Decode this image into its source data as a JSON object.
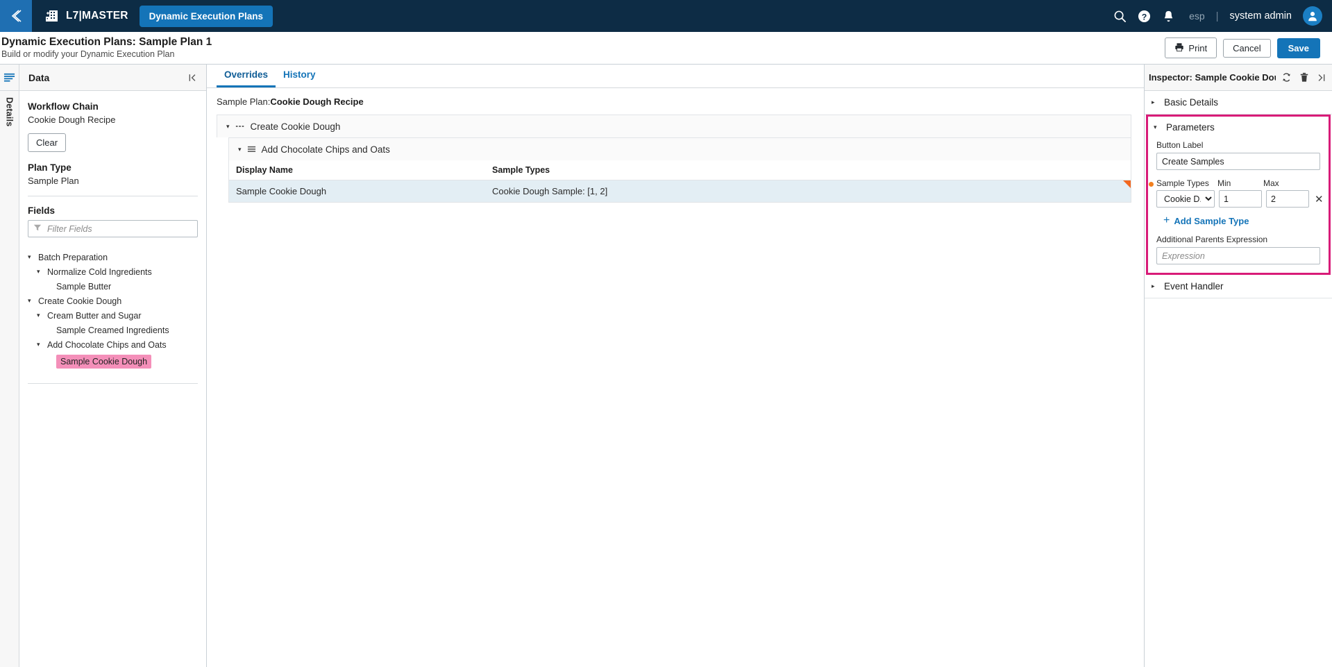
{
  "topnav": {
    "back_icon": "chevron-left-icon",
    "brand_logo_icon": "building-add-icon",
    "brand_name": "L7|MASTER",
    "active_tab": "Dynamic Execution Plans",
    "search_icon": "search-icon",
    "help_icon": "help-circle-icon",
    "notifications_icon": "bell-icon",
    "language": "esp",
    "separator": "|",
    "user": "system admin",
    "avatar_icon": "user-avatar-icon"
  },
  "pagehead": {
    "title": "Dynamic Execution Plans: Sample Plan 1",
    "subtitle": "Build or modify your Dynamic Execution Plan",
    "print_label": "Print",
    "print_icon": "printer-icon",
    "cancel_label": "Cancel",
    "save_label": "Save"
  },
  "rail": {
    "menu_icon": "hamburger-menu-icon",
    "details_tab": "Details"
  },
  "datapanel": {
    "header": "Data",
    "collapse_icon": "collapse-left-icon",
    "workflow_chain_label": "Workflow Chain",
    "workflow_chain_value": "Cookie Dough Recipe",
    "clear_label": "Clear",
    "plan_type_label": "Plan Type",
    "plan_type_value": "Sample Plan",
    "fields_label": "Fields",
    "filter_placeholder": "Filter Fields",
    "filter_value": "",
    "filter_icon": "funnel-icon",
    "tree": [
      {
        "label": "Batch Preparation",
        "depth": 0,
        "caret": "▾",
        "highlight": false
      },
      {
        "label": "Normalize Cold Ingredients",
        "depth": 1,
        "caret": "▾",
        "highlight": false
      },
      {
        "label": "Sample Butter",
        "depth": 2,
        "caret": "",
        "highlight": false
      },
      {
        "label": "Create Cookie Dough",
        "depth": 0,
        "caret": "▾",
        "highlight": false
      },
      {
        "label": "Cream Butter and Sugar",
        "depth": 1,
        "caret": "▾",
        "highlight": false
      },
      {
        "label": "Sample Creamed Ingredients",
        "depth": 2,
        "caret": "",
        "highlight": false
      },
      {
        "label": "Add Chocolate Chips and Oats",
        "depth": 1,
        "caret": "▾",
        "highlight": false
      },
      {
        "label": "Sample Cookie Dough",
        "depth": 2,
        "caret": "",
        "highlight": true
      }
    ]
  },
  "center": {
    "tabs": [
      {
        "label": "Overrides",
        "active": true
      },
      {
        "label": "History",
        "active": false
      }
    ],
    "breadcrumb_prefix": "Sample Plan:",
    "breadcrumb_value": "Cookie Dough Recipe",
    "nodes": [
      {
        "label": "Create Cookie Dough",
        "level": 1,
        "caret": "▾",
        "icon": "dots-horizontal-icon"
      },
      {
        "label": "Add Chocolate Chips and Oats",
        "level": 2,
        "caret": "▾",
        "icon": "list-lines-icon"
      }
    ],
    "grid": {
      "columns": [
        "Display Name",
        "Sample Types"
      ],
      "rows": [
        {
          "display_name": "Sample Cookie Dough",
          "sample_types": "Cookie Dough Sample: [1, 2]",
          "selected": true,
          "flagged": true
        }
      ]
    }
  },
  "inspector": {
    "title": "Inspector: Sample Cookie Dough",
    "refresh_icon": "sync-refresh-icon",
    "delete_icon": "trash-icon",
    "collapse_icon": "collapse-right-icon",
    "basic_details_label": "Basic Details",
    "basic_details_caret": "▸",
    "parameters_label": "Parameters",
    "parameters_caret": "▾",
    "button_label_label": "Button Label",
    "button_label_value": "Create Samples",
    "sample_types_label": "Sample Types",
    "min_label": "Min",
    "max_label": "Max",
    "sample_type_value": "Cookie D...",
    "min_value": "1",
    "max_value": "2",
    "remove_row_icon": "close-x-icon",
    "add_sample_type_label": "Add Sample Type",
    "add_icon": "plus-icon",
    "additional_parents_label": "Additional Parents Expression",
    "additional_parents_placeholder": "Expression",
    "additional_parents_value": "",
    "event_handler_label": "Event Handler",
    "event_handler_caret": "▸",
    "highlight_color": "#d81b78",
    "required_dot_color": "#f2801f"
  }
}
